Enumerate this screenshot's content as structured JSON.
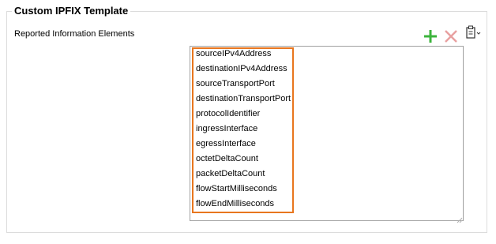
{
  "group": {
    "title": "Custom IPFIX Template"
  },
  "field": {
    "label": "Reported Information Elements"
  },
  "toolbar": {
    "add_icon": "plus-icon",
    "delete_icon": "x-icon",
    "paste_icon": "clipboard-icon"
  },
  "colors": {
    "highlight": "#e8761e",
    "add": "#3cb43c",
    "delete": "#e8a0a0"
  },
  "list": {
    "items": [
      "sourceIPv4Address",
      "destinationIPv4Address",
      "sourceTransportPort",
      "destinationTransportPort",
      "protocolIdentifier",
      "ingressInterface",
      "egressInterface",
      "octetDeltaCount",
      "packetDeltaCount",
      "flowStartMilliseconds",
      "flowEndMilliseconds"
    ]
  }
}
